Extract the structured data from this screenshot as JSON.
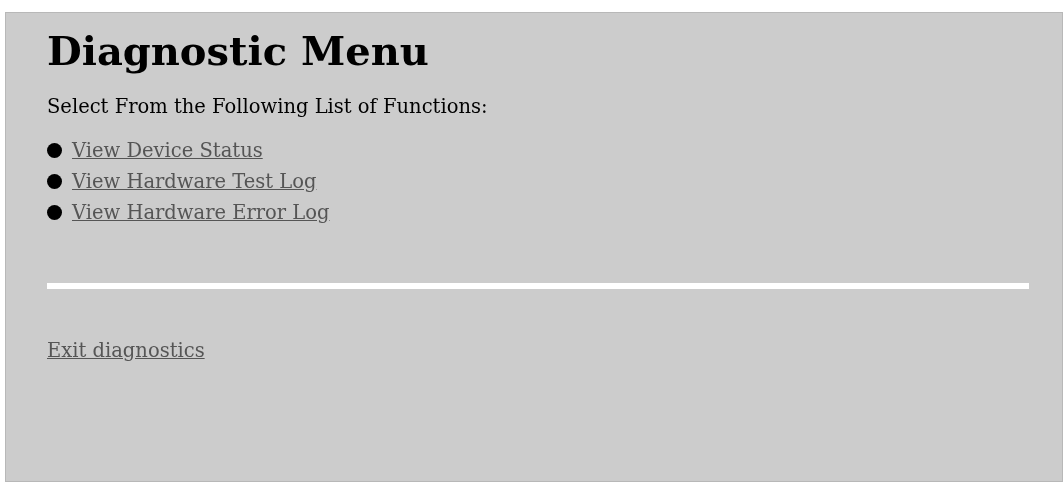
{
  "title": "Diagnostic Menu",
  "intro": "Select From the Following List of Functions:",
  "functions": [
    "View Device Status",
    "View Hardware Test Log",
    "View Hardware Error Log"
  ],
  "exit_link": "Exit diagnostics"
}
